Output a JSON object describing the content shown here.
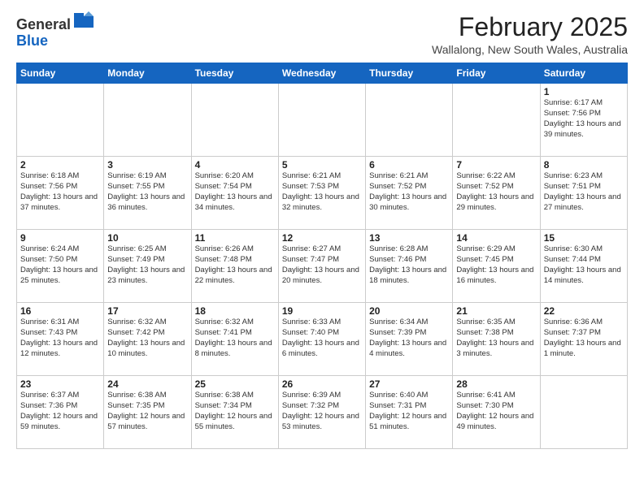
{
  "header": {
    "logo_general": "General",
    "logo_blue": "Blue",
    "month_title": "February 2025",
    "location": "Wallalong, New South Wales, Australia"
  },
  "weekdays": [
    "Sunday",
    "Monday",
    "Tuesday",
    "Wednesday",
    "Thursday",
    "Friday",
    "Saturday"
  ],
  "weeks": [
    [
      {
        "day": "",
        "info": ""
      },
      {
        "day": "",
        "info": ""
      },
      {
        "day": "",
        "info": ""
      },
      {
        "day": "",
        "info": ""
      },
      {
        "day": "",
        "info": ""
      },
      {
        "day": "",
        "info": ""
      },
      {
        "day": "1",
        "info": "Sunrise: 6:17 AM\nSunset: 7:56 PM\nDaylight: 13 hours\nand 39 minutes."
      }
    ],
    [
      {
        "day": "2",
        "info": "Sunrise: 6:18 AM\nSunset: 7:56 PM\nDaylight: 13 hours\nand 37 minutes."
      },
      {
        "day": "3",
        "info": "Sunrise: 6:19 AM\nSunset: 7:55 PM\nDaylight: 13 hours\nand 36 minutes."
      },
      {
        "day": "4",
        "info": "Sunrise: 6:20 AM\nSunset: 7:54 PM\nDaylight: 13 hours\nand 34 minutes."
      },
      {
        "day": "5",
        "info": "Sunrise: 6:21 AM\nSunset: 7:53 PM\nDaylight: 13 hours\nand 32 minutes."
      },
      {
        "day": "6",
        "info": "Sunrise: 6:21 AM\nSunset: 7:52 PM\nDaylight: 13 hours\nand 30 minutes."
      },
      {
        "day": "7",
        "info": "Sunrise: 6:22 AM\nSunset: 7:52 PM\nDaylight: 13 hours\nand 29 minutes."
      },
      {
        "day": "8",
        "info": "Sunrise: 6:23 AM\nSunset: 7:51 PM\nDaylight: 13 hours\nand 27 minutes."
      }
    ],
    [
      {
        "day": "9",
        "info": "Sunrise: 6:24 AM\nSunset: 7:50 PM\nDaylight: 13 hours\nand 25 minutes."
      },
      {
        "day": "10",
        "info": "Sunrise: 6:25 AM\nSunset: 7:49 PM\nDaylight: 13 hours\nand 23 minutes."
      },
      {
        "day": "11",
        "info": "Sunrise: 6:26 AM\nSunset: 7:48 PM\nDaylight: 13 hours\nand 22 minutes."
      },
      {
        "day": "12",
        "info": "Sunrise: 6:27 AM\nSunset: 7:47 PM\nDaylight: 13 hours\nand 20 minutes."
      },
      {
        "day": "13",
        "info": "Sunrise: 6:28 AM\nSunset: 7:46 PM\nDaylight: 13 hours\nand 18 minutes."
      },
      {
        "day": "14",
        "info": "Sunrise: 6:29 AM\nSunset: 7:45 PM\nDaylight: 13 hours\nand 16 minutes."
      },
      {
        "day": "15",
        "info": "Sunrise: 6:30 AM\nSunset: 7:44 PM\nDaylight: 13 hours\nand 14 minutes."
      }
    ],
    [
      {
        "day": "16",
        "info": "Sunrise: 6:31 AM\nSunset: 7:43 PM\nDaylight: 13 hours\nand 12 minutes."
      },
      {
        "day": "17",
        "info": "Sunrise: 6:32 AM\nSunset: 7:42 PM\nDaylight: 13 hours\nand 10 minutes."
      },
      {
        "day": "18",
        "info": "Sunrise: 6:32 AM\nSunset: 7:41 PM\nDaylight: 13 hours\nand 8 minutes."
      },
      {
        "day": "19",
        "info": "Sunrise: 6:33 AM\nSunset: 7:40 PM\nDaylight: 13 hours\nand 6 minutes."
      },
      {
        "day": "20",
        "info": "Sunrise: 6:34 AM\nSunset: 7:39 PM\nDaylight: 13 hours\nand 4 minutes."
      },
      {
        "day": "21",
        "info": "Sunrise: 6:35 AM\nSunset: 7:38 PM\nDaylight: 13 hours\nand 3 minutes."
      },
      {
        "day": "22",
        "info": "Sunrise: 6:36 AM\nSunset: 7:37 PM\nDaylight: 13 hours\nand 1 minute."
      }
    ],
    [
      {
        "day": "23",
        "info": "Sunrise: 6:37 AM\nSunset: 7:36 PM\nDaylight: 12 hours\nand 59 minutes."
      },
      {
        "day": "24",
        "info": "Sunrise: 6:38 AM\nSunset: 7:35 PM\nDaylight: 12 hours\nand 57 minutes."
      },
      {
        "day": "25",
        "info": "Sunrise: 6:38 AM\nSunset: 7:34 PM\nDaylight: 12 hours\nand 55 minutes."
      },
      {
        "day": "26",
        "info": "Sunrise: 6:39 AM\nSunset: 7:32 PM\nDaylight: 12 hours\nand 53 minutes."
      },
      {
        "day": "27",
        "info": "Sunrise: 6:40 AM\nSunset: 7:31 PM\nDaylight: 12 hours\nand 51 minutes."
      },
      {
        "day": "28",
        "info": "Sunrise: 6:41 AM\nSunset: 7:30 PM\nDaylight: 12 hours\nand 49 minutes."
      },
      {
        "day": "",
        "info": ""
      }
    ]
  ]
}
